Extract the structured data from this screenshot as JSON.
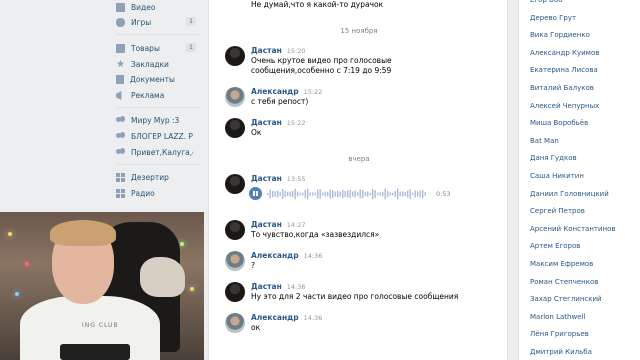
{
  "nav": {
    "items": [
      {
        "label": "Видео",
        "icon": "video-icon",
        "badge": ""
      },
      {
        "label": "Игры",
        "icon": "gamepad-icon",
        "badge": "1"
      },
      {
        "label": "Товары",
        "icon": "bag-icon",
        "badge": "1"
      },
      {
        "label": "Закладки",
        "icon": "star-icon",
        "badge": ""
      },
      {
        "label": "Документы",
        "icon": "document-icon",
        "badge": ""
      },
      {
        "label": "Реклама",
        "icon": "megaphone-icon",
        "badge": ""
      },
      {
        "label": "Миру Мур :3",
        "icon": "group-icon",
        "badge": ""
      },
      {
        "label": "БЛОГЕР LAZZ. Ра...",
        "icon": "group-icon",
        "badge": ""
      },
      {
        "label": "Привет,Калуга,с...",
        "icon": "group-icon",
        "badge": ""
      },
      {
        "label": "Дезертир",
        "icon": "app-icon",
        "badge": ""
      },
      {
        "label": "Радио",
        "icon": "app-icon",
        "badge": ""
      }
    ]
  },
  "chat": {
    "top_message": "Не думай,что я какой-то дурачок",
    "date_1": "15 ноября",
    "date_2": "вчера",
    "messages": [
      {
        "author": "Дастан",
        "time": "15:20",
        "text": "Очень крутое видео про голосовые сообщения,особенно с 7:19 до 9:59"
      },
      {
        "author": "Александр",
        "time": "15:22",
        "text": "с тебя репост)"
      },
      {
        "author": "Дастан",
        "time": "15:22",
        "text": "Ок"
      },
      {
        "author": "Дастан",
        "time": "13:55",
        "text": ""
      },
      {
        "author": "Дастан",
        "time": "14:27",
        "text": "То чувство,когда «зазвездился»"
      },
      {
        "author": "Александр",
        "time": "14:36",
        "text": "?"
      },
      {
        "author": "Дастан",
        "time": "14:36",
        "text": "Ну это для 2 части видео про голосовые сообщения"
      },
      {
        "author": "Александр",
        "time": "14:36",
        "text": "ок"
      }
    ],
    "voice_duration": "0:53"
  },
  "friends": [
    "Егор Боб",
    "Дерево Грут",
    "Вика Гордиенко",
    "Александр Куимов",
    "Екатерина Лисова",
    "Виталий Балуков",
    "Алексей Чепурных",
    "Миша Воробьёв",
    "Bat Man",
    "Даня Гудков",
    "Саша Никитин",
    "Даниил Головницкий",
    "Сергей Петров",
    "Арсений Константинов",
    "Артем Егоров",
    "Максим Ефремов",
    "Роман Степченков",
    "Захар Стеглинский",
    "Marlon Lathwell",
    "Лёня Григорьев",
    "Дмитрий Кильба"
  ],
  "webcam": {
    "shirt_text": "ING CLUB"
  },
  "colors": {
    "link": "#2a5885",
    "accent": "#5181b8",
    "background": "#edeef0"
  }
}
